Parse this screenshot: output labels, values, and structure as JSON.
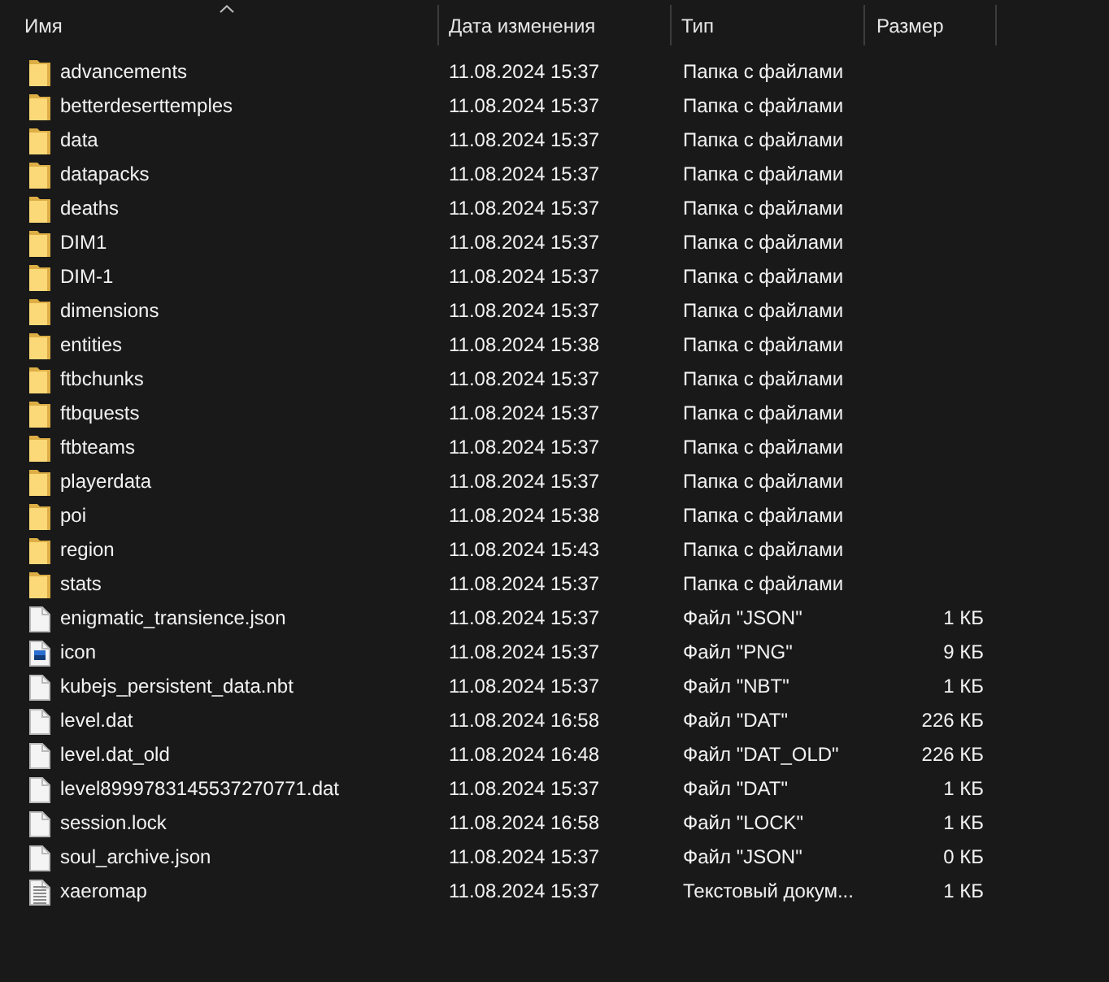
{
  "columns": [
    {
      "label": "Имя",
      "sorted": true
    },
    {
      "label": "Дата изменения",
      "sorted": false
    },
    {
      "label": "Тип",
      "sorted": false
    },
    {
      "label": "Размер",
      "sorted": false
    }
  ],
  "rows": [
    {
      "kind": "folder",
      "name": "advancements",
      "modified": "11.08.2024 15:37",
      "type": "Папка с файлами"
    },
    {
      "kind": "folder",
      "name": "betterdeserttemples",
      "modified": "11.08.2024 15:37",
      "type": "Папка с файлами"
    },
    {
      "kind": "folder",
      "name": "data",
      "modified": "11.08.2024 15:37",
      "type": "Папка с файлами"
    },
    {
      "kind": "folder",
      "name": "datapacks",
      "modified": "11.08.2024 15:37",
      "type": "Папка с файлами"
    },
    {
      "kind": "folder",
      "name": "deaths",
      "modified": "11.08.2024 15:37",
      "type": "Папка с файлами"
    },
    {
      "kind": "folder",
      "name": "DIM1",
      "modified": "11.08.2024 15:37",
      "type": "Папка с файлами"
    },
    {
      "kind": "folder",
      "name": "DIM-1",
      "modified": "11.08.2024 15:37",
      "type": "Папка с файлами"
    },
    {
      "kind": "folder",
      "name": "dimensions",
      "modified": "11.08.2024 15:37",
      "type": "Папка с файлами"
    },
    {
      "kind": "folder",
      "name": "entities",
      "modified": "11.08.2024 15:38",
      "type": "Папка с файлами"
    },
    {
      "kind": "folder",
      "name": "ftbchunks",
      "modified": "11.08.2024 15:37",
      "type": "Папка с файлами"
    },
    {
      "kind": "folder",
      "name": "ftbquests",
      "modified": "11.08.2024 15:37",
      "type": "Папка с файлами"
    },
    {
      "kind": "folder",
      "name": "ftbteams",
      "modified": "11.08.2024 15:37",
      "type": "Папка с файлами"
    },
    {
      "kind": "folder",
      "name": "playerdata",
      "modified": "11.08.2024 15:37",
      "type": "Папка с файлами"
    },
    {
      "kind": "folder",
      "name": "poi",
      "modified": "11.08.2024 15:38",
      "type": "Папка с файлами"
    },
    {
      "kind": "folder",
      "name": "region",
      "modified": "11.08.2024 15:43",
      "type": "Папка с файлами"
    },
    {
      "kind": "folder",
      "name": "stats",
      "modified": "11.08.2024 15:37",
      "type": "Папка с файлами"
    },
    {
      "kind": "file",
      "name": "enigmatic_transience.json",
      "modified": "11.08.2024 15:37",
      "type": "Файл \"JSON\"",
      "size": "1 КБ"
    },
    {
      "kind": "image",
      "name": "icon",
      "modified": "11.08.2024 15:37",
      "type": "Файл \"PNG\"",
      "size": "9 КБ"
    },
    {
      "kind": "file",
      "name": "kubejs_persistent_data.nbt",
      "modified": "11.08.2024 15:37",
      "type": "Файл \"NBT\"",
      "size": "1 КБ"
    },
    {
      "kind": "file",
      "name": "level.dat",
      "modified": "11.08.2024 16:58",
      "type": "Файл \"DAT\"",
      "size": "226 КБ"
    },
    {
      "kind": "file",
      "name": "level.dat_old",
      "modified": "11.08.2024 16:48",
      "type": "Файл \"DAT_OLD\"",
      "size": "226 КБ"
    },
    {
      "kind": "file",
      "name": "level8999783145537270771.dat",
      "modified": "11.08.2024 15:37",
      "type": "Файл \"DAT\"",
      "size": "1 КБ"
    },
    {
      "kind": "file",
      "name": "session.lock",
      "modified": "11.08.2024 16:58",
      "type": "Файл \"LOCK\"",
      "size": "1 КБ"
    },
    {
      "kind": "file",
      "name": "soul_archive.json",
      "modified": "11.08.2024 15:37",
      "type": "Файл \"JSON\"",
      "size": "0 КБ"
    },
    {
      "kind": "text",
      "name": "xaeromap",
      "modified": "11.08.2024 15:37",
      "type": "Текстовый докум...",
      "size": "1 КБ"
    }
  ]
}
